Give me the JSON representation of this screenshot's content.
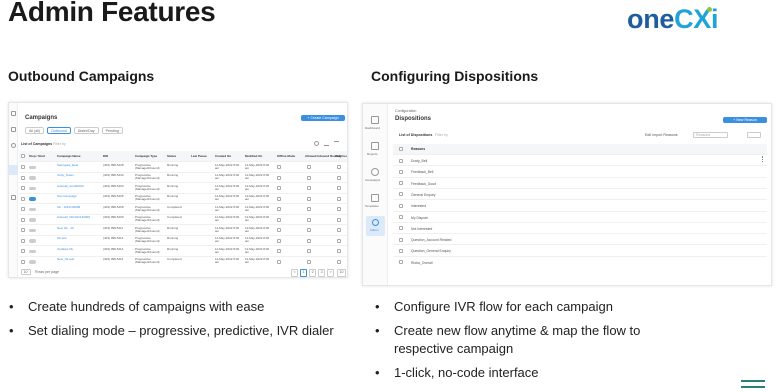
{
  "title": "Admin Features",
  "logo": {
    "left": "one",
    "right": "CXi"
  },
  "left": {
    "heading": "Outbound Campaigns",
    "screenshot": {
      "page_title": "Campaigns",
      "create_button": "+ Create Campaign",
      "tabs": [
        "All (all)",
        "Outbound",
        "Dialer/Day",
        "Pending"
      ],
      "list_label": "List of Campaigns",
      "filter": "Filter by",
      "columns": [
        "Stop / Start",
        "Campaign Name",
        "DID",
        "Campaign Type",
        "Status",
        "Last Pause",
        "Created On",
        "Modified On",
        "Offline Mode",
        "Allowed Inbound Routing",
        "Call Customer Flow"
      ],
      "rows": [
        {
          "name": "Samsgate_Eeel",
          "did": "(403) 098-5128",
          "type": "Progressive (Manage/Inbound)",
          "status": "Running",
          "created": "11-May-2022 8:00 am",
          "modified": "11-May-2022 8:00 am",
          "on": false
        },
        {
          "name": "Outly_Tester",
          "did": "(403) 098-5133",
          "type": "Progressive (Manage/Inbound)",
          "status": "Running",
          "created": "11-May-2022 8:00 am",
          "modified": "11-May-2022 8:00 am",
          "on": false
        },
        {
          "name": "Autocall_Auto60012",
          "did": "(403) 098-5103",
          "type": "Progressive (Manage/Inbound)",
          "status": "Running",
          "created": "11-May-2022 8:00 am",
          "modified": "11-May-2022 8:00 am",
          "on": false
        },
        {
          "name": "Test Campaign",
          "did": "(403) 098-5105",
          "type": "Progressive (Manage/Inbound)",
          "status": "Running",
          "created": "11-May-2022 8:00 am",
          "modified": "11-May-2022 8:00 am",
          "on": true
        },
        {
          "name": "Ok - 1012133008",
          "did": "(403) 098-5108",
          "type": "Progressive (Manage/Inbound)",
          "status": "Completed",
          "created": "11-May-2022 8:00 am",
          "modified": "11-May-2022 8:00 am",
          "on": false
        },
        {
          "name": "Autocall_Ok1012133008",
          "did": "(403) 098-5109",
          "type": "Progressive (Manage/Inbound)",
          "status": "Completed",
          "created": "11-May-2022 8:00 am",
          "modified": "11-May-2022 8:00 am",
          "on": false
        },
        {
          "name": "New Ok - 10",
          "did": "(403) 098-5111",
          "type": "Progressive (Manage/Inbound)",
          "status": "Running",
          "created": "11-May-2022 8:00 am",
          "modified": "11-May-2022 8:00 am",
          "on": false
        },
        {
          "name": "Ok test",
          "did": "(403) 098-5112",
          "type": "Progressive (Manage/Inbound)",
          "status": "Running",
          "created": "11-May-2022 8:00 am",
          "modified": "11-May-2022 8:00 am",
          "on": false
        },
        {
          "name": "Updated Ok",
          "did": "(403) 098-5114",
          "type": "Progressive (Manage/Inbound)",
          "status": "Running",
          "created": "11-May-2022 8:00 am",
          "modified": "11-May-2022 8:00 am",
          "on": false
        },
        {
          "name": "New_Ok test",
          "did": "(403) 098-5114",
          "type": "Progressive (Manage/Inbound)",
          "status": "Completed",
          "created": "11-May-2022 8:00 am",
          "modified": "11-May-2022 8:00 am",
          "on": false
        }
      ],
      "per_page": "10",
      "per_page_label": "Rows per page",
      "pages": [
        "<",
        "1",
        "2",
        "3",
        ">"
      ],
      "last_page": "10"
    },
    "bullets": [
      "Create hundreds of campaigns with ease",
      "Set dialing mode – progressive, predictive, IVR dialer"
    ]
  },
  "right": {
    "heading": "Configuring Dispositions",
    "screenshot": {
      "breadcrumb": "Configuration",
      "page_title": "Dispositions",
      "new_button": "+ New Reason",
      "list_label": "List of Dispositions",
      "filter": "Filter by",
      "edit_link": "Edit Import Reasons",
      "select_placeholder": "Reasons",
      "column": "Reasons",
      "nav": [
        "Dashboard",
        "Reports",
        "Campaigns",
        "Templates",
        "Admin"
      ],
      "rows": [
        "Dusty_Bell",
        "Feedback_Bell",
        "Feedback_Good",
        "General Enquiry",
        "Interested",
        "My Dispute",
        "Not Interested",
        "Question_Account Related",
        "Question_General Enquiry",
        "Rioba_Overall"
      ]
    },
    "bullets": [
      "Configure IVR flow for each campaign",
      "Create new flow anytime & map the flow to respective campaign",
      "1-click, no-code interface"
    ]
  }
}
